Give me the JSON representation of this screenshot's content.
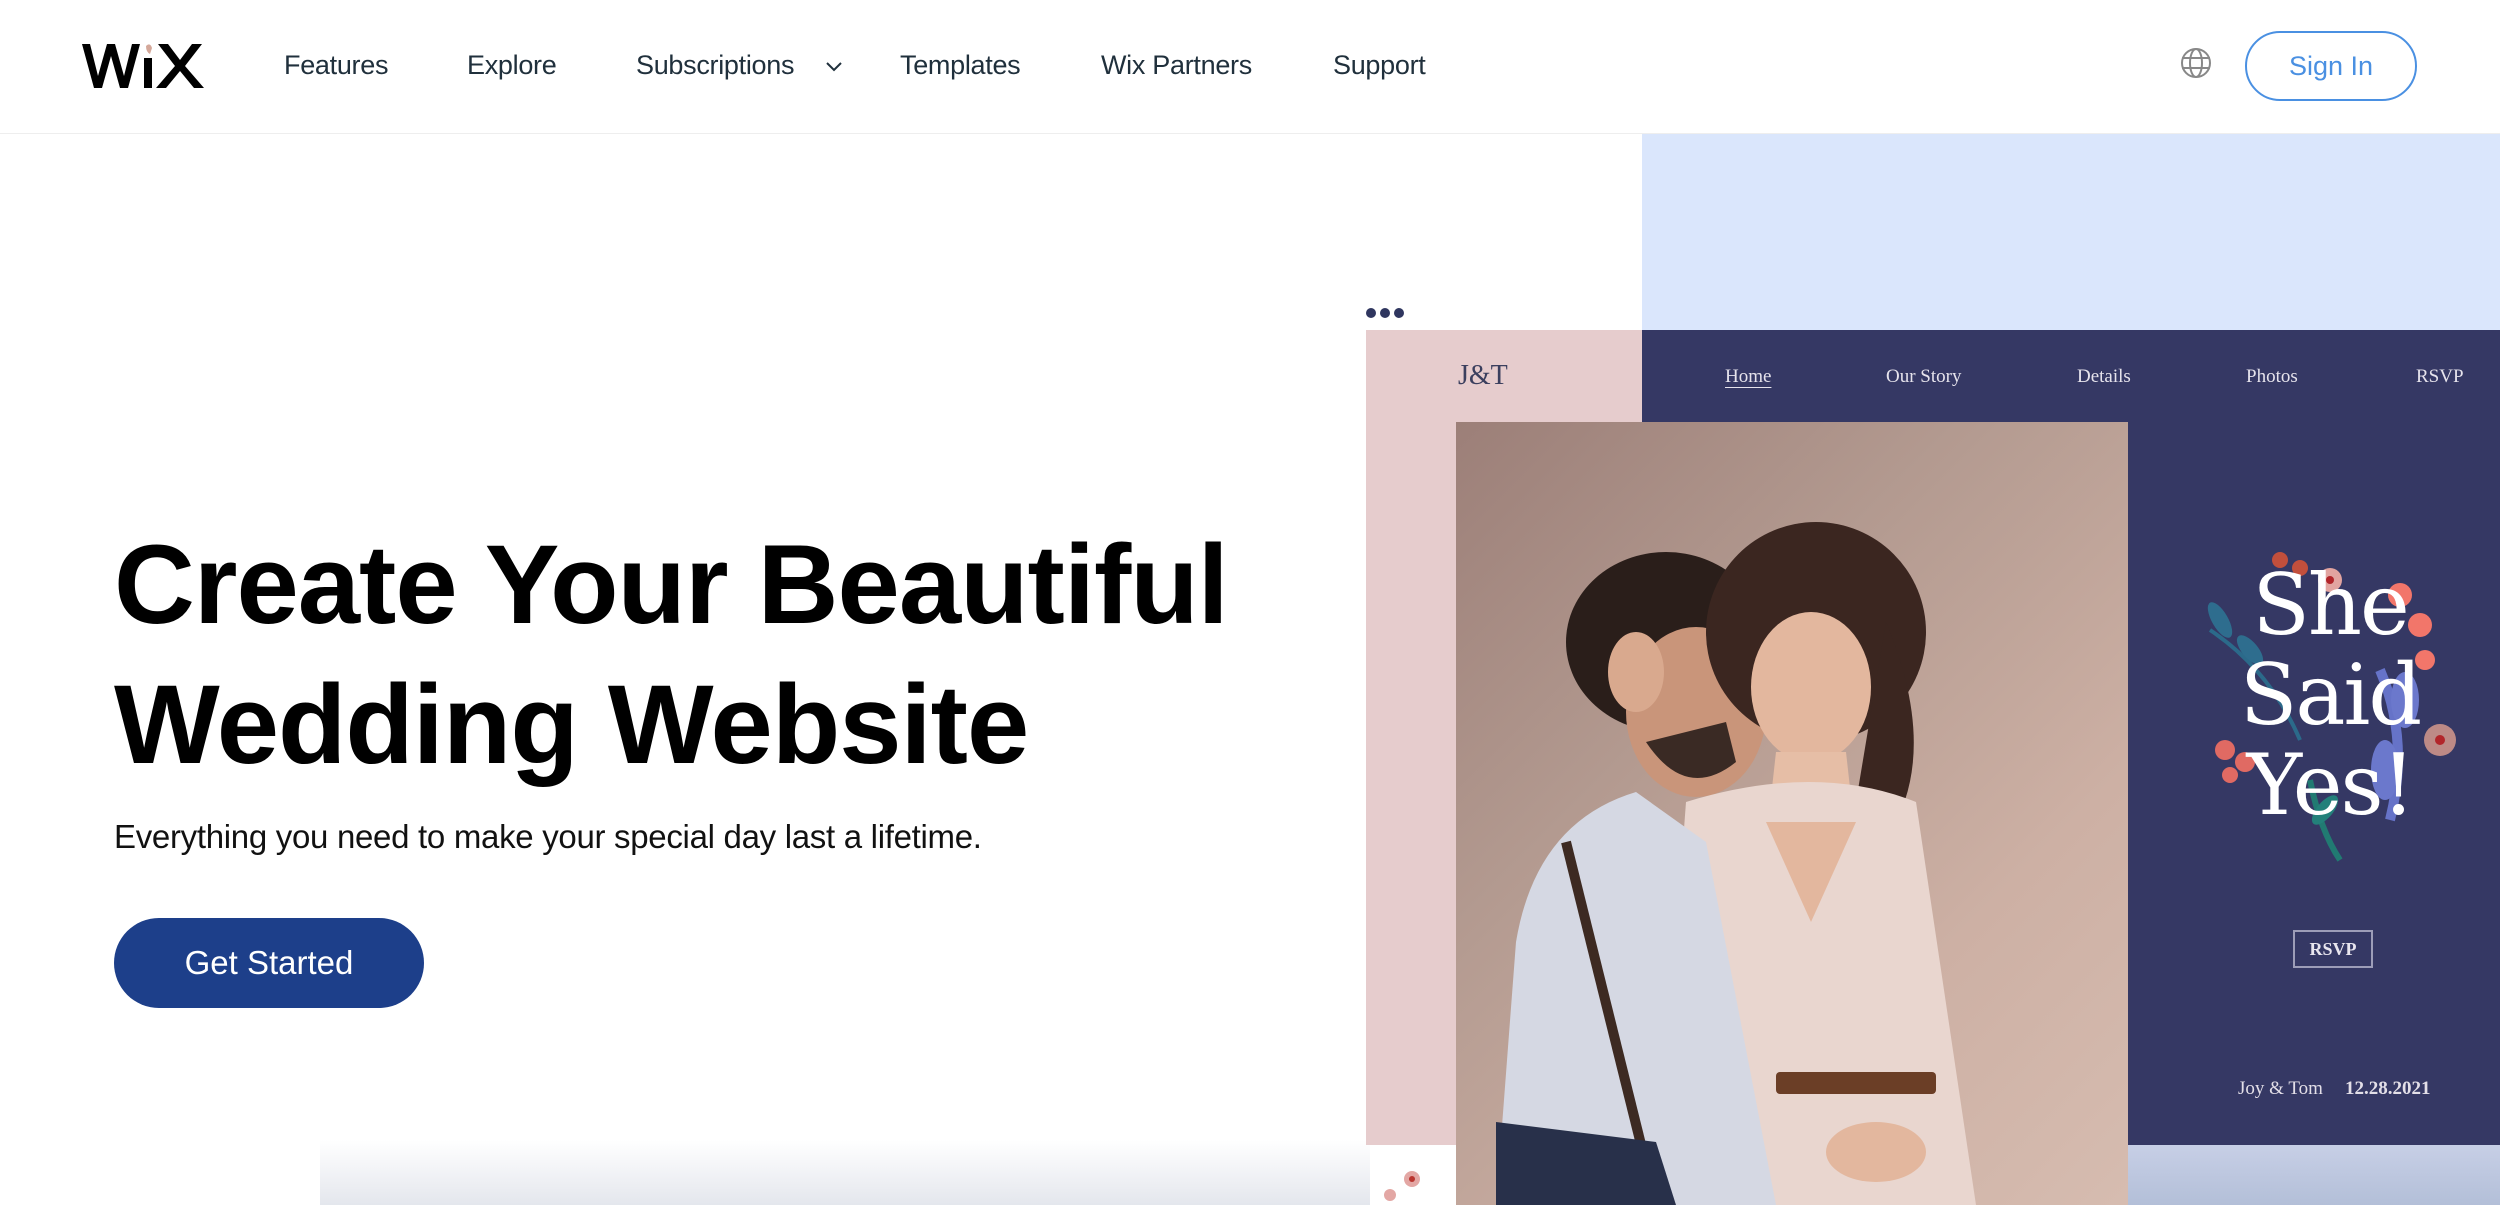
{
  "header": {
    "logo_text": "WiX",
    "nav": [
      {
        "label": "Features"
      },
      {
        "label": "Explore"
      },
      {
        "label": "Subscriptions",
        "has_dropdown": true
      },
      {
        "label": "Templates"
      },
      {
        "label": "Wix Partners"
      },
      {
        "label": "Support"
      }
    ],
    "language_icon": "globe-icon",
    "sign_in_label": "Sign In"
  },
  "hero": {
    "title_line1": "Create Your Beautiful",
    "title_line2": "Wedding Website",
    "subtitle": "Everything you need to make your special day last a lifetime.",
    "cta_label": "Get Started"
  },
  "preview": {
    "monogram": "J&T",
    "nav": [
      {
        "label": "Home",
        "active": true
      },
      {
        "label": "Our Story"
      },
      {
        "label": "Details"
      },
      {
        "label": "Photos"
      },
      {
        "label": "RSVP"
      }
    ],
    "headline": [
      "She",
      "Said",
      "Yes!"
    ],
    "rsvp_label": "RSVP",
    "names": "Joy & Tom",
    "date": "12.28.2021"
  },
  "colors": {
    "accent_blue": "#4a90e2",
    "cta_blue": "#1d3f8a",
    "preview_navy": "#353864",
    "preview_pink": "#e6cccd",
    "preview_bg_blue": "#dae6fc"
  }
}
